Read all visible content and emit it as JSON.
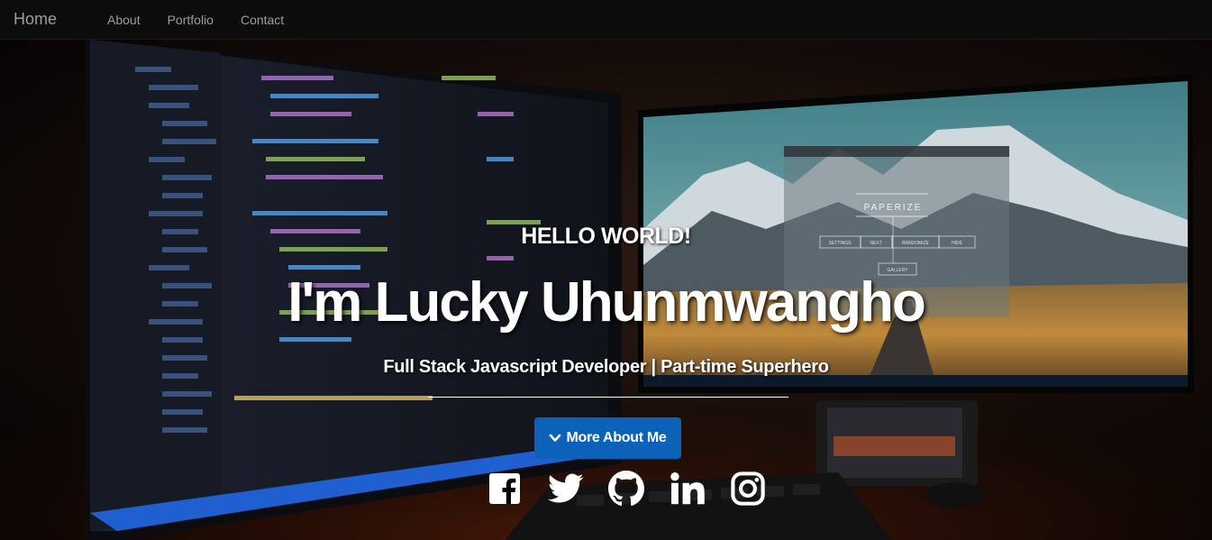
{
  "nav": {
    "brand": "Home",
    "links": [
      "About",
      "Portfolio",
      "Contact"
    ]
  },
  "monitor": {
    "app_title": "PAPERIZE",
    "buttons": [
      "SETTINGS",
      "NEXT",
      "RANDOMIZE",
      "HIDE"
    ],
    "gallery_label": "GALLERY"
  },
  "hero": {
    "kicker": "HELLO WORLD!",
    "title": "I'm Lucky Uhunmwangho",
    "subtitle": "Full Stack Javascript Developer | Part-time Superhero",
    "more_label": "More About Me"
  },
  "socials": [
    {
      "icon": "facebook-icon"
    },
    {
      "icon": "twitter-icon"
    },
    {
      "icon": "github-icon"
    },
    {
      "icon": "linkedin-icon"
    },
    {
      "icon": "instagram-icon"
    }
  ],
  "colors": {
    "navbar": "#0c0c0c",
    "nav_text": "#9d9d9d",
    "button": "#0b62b8",
    "text": "#ffffff"
  }
}
